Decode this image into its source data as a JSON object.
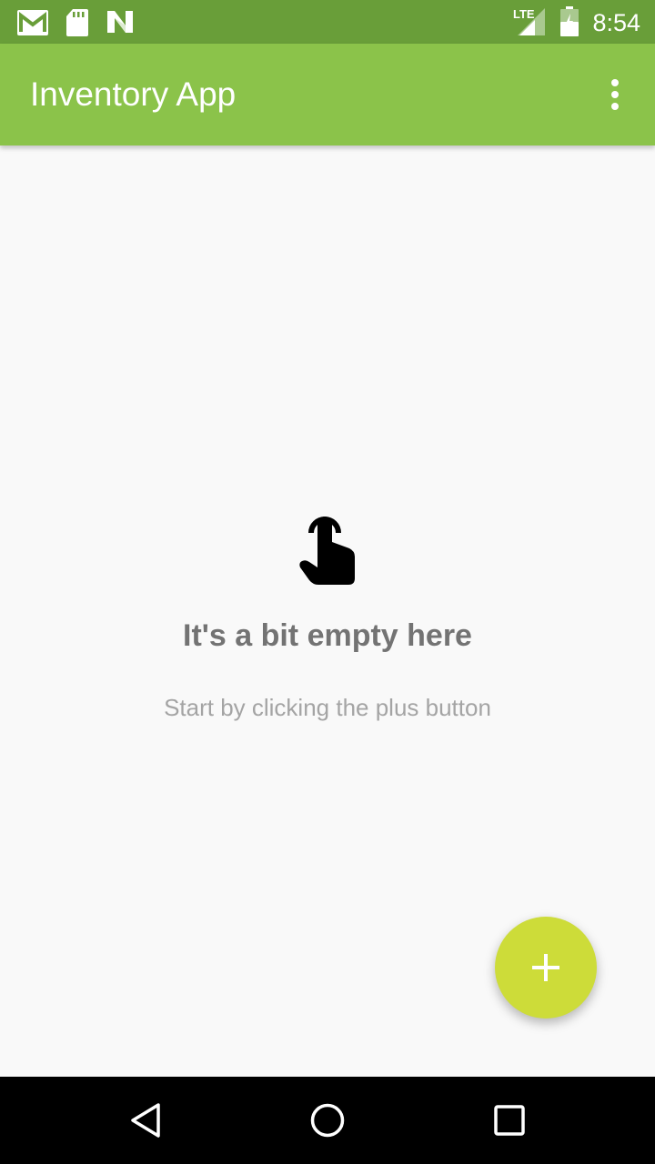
{
  "status_bar": {
    "time": "8:54",
    "network_label": "LTE",
    "icons": [
      "gmail-icon",
      "sd-card-icon",
      "n-preview-icon",
      "lte-signal-icon",
      "battery-icon"
    ]
  },
  "app_bar": {
    "title": "Inventory App",
    "overflow_icon": "more-vert-icon"
  },
  "empty_state": {
    "icon": "touch-hand-icon",
    "title": "It's a bit empty here",
    "subtitle": "Start by clicking the plus button"
  },
  "fab": {
    "icon": "plus-icon",
    "color": "#cddc39"
  },
  "nav_bar": {
    "buttons": [
      "back-icon",
      "home-icon",
      "recents-icon"
    ]
  },
  "colors": {
    "status_bar": "#699e39",
    "app_bar": "#8bc34a",
    "background": "#f9f9f9",
    "fab": "#cddc39"
  }
}
